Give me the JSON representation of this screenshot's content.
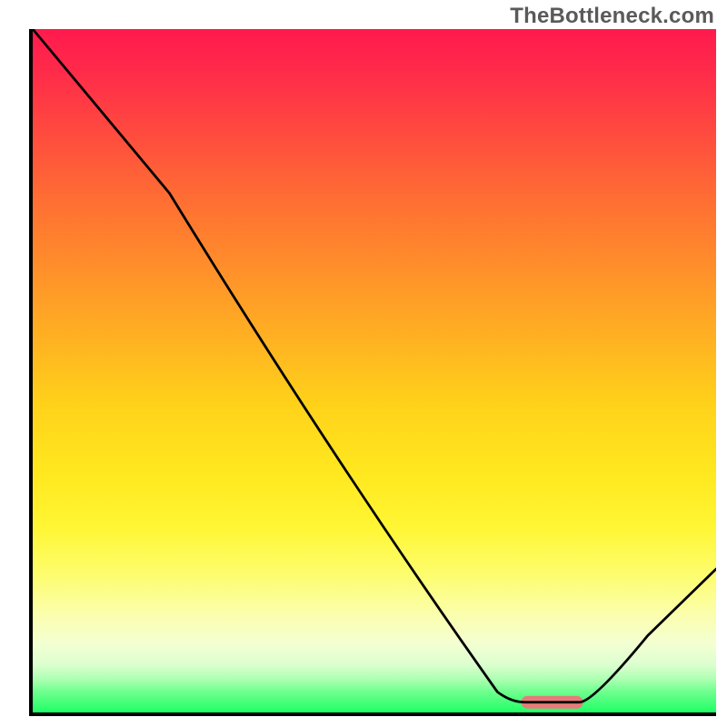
{
  "watermark": "TheBottleneck.com",
  "chart_data": {
    "type": "line",
    "title": "",
    "xlabel": "",
    "ylabel": "",
    "xlim": [
      0,
      100
    ],
    "ylim": [
      0,
      100
    ],
    "series": [
      {
        "name": "bottleneck-curve",
        "x": [
          0,
          20,
          68,
          72,
          80,
          100
        ],
        "values": [
          100,
          76,
          3,
          1.5,
          1.5,
          21
        ]
      }
    ],
    "marker": {
      "name": "optimal-range",
      "x_start": 72,
      "x_end": 80,
      "y": 1.5,
      "color": "#e77a7a"
    },
    "gradient_colors_top_to_bottom": [
      "#ff1a4d",
      "#ff4a3f",
      "#ff8f2a",
      "#ffd21a",
      "#fff634",
      "#fbfeb0",
      "#b0ffb4",
      "#1eff65"
    ]
  }
}
